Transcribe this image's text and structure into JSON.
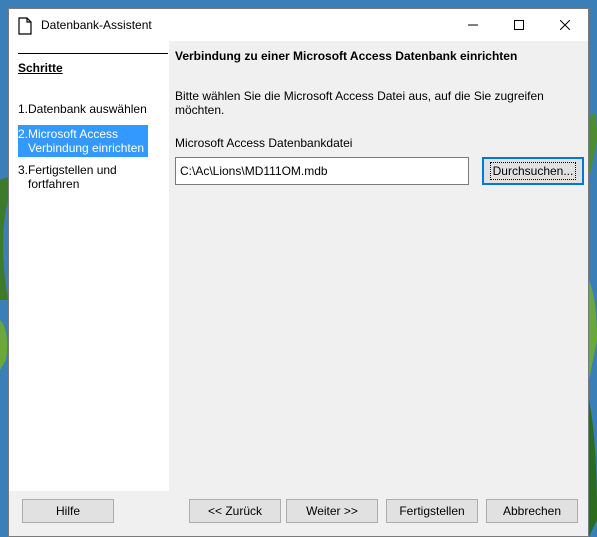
{
  "window": {
    "title": "Datenbank-Assistent",
    "controls": {
      "minimize": "minimize",
      "maximize": "maximize",
      "close": "close"
    }
  },
  "sidebar": {
    "title": "Schritte",
    "steps": [
      {
        "num": "1.",
        "label": "Datenbank auswählen",
        "active": false
      },
      {
        "num": "2.",
        "label": "Microsoft Access Verbindung einrichten",
        "active": true
      },
      {
        "num": "3.",
        "label": "Fertigstellen und fortfahren",
        "active": false
      }
    ]
  },
  "main": {
    "header": "Verbindung zu einer Microsoft Access Datenbank einrichten",
    "description": "Bitte wählen Sie die Microsoft Access Datei aus, auf die Sie zugreifen möchten.",
    "file_label": "Microsoft Access Datenbankdatei",
    "file_value": "C:\\Ac\\Lions\\MD111OM.mdb",
    "browse_label": "Durchsuchen..."
  },
  "buttons": {
    "help": "Hilfe",
    "back": "<< Zurück",
    "next": "Weiter >>",
    "finish": "Fertigstellen",
    "cancel": "Abbrechen"
  },
  "colors": {
    "accent": "#3399ff",
    "focus_border": "#0078d7",
    "window_bg": "#f0f0f0"
  }
}
